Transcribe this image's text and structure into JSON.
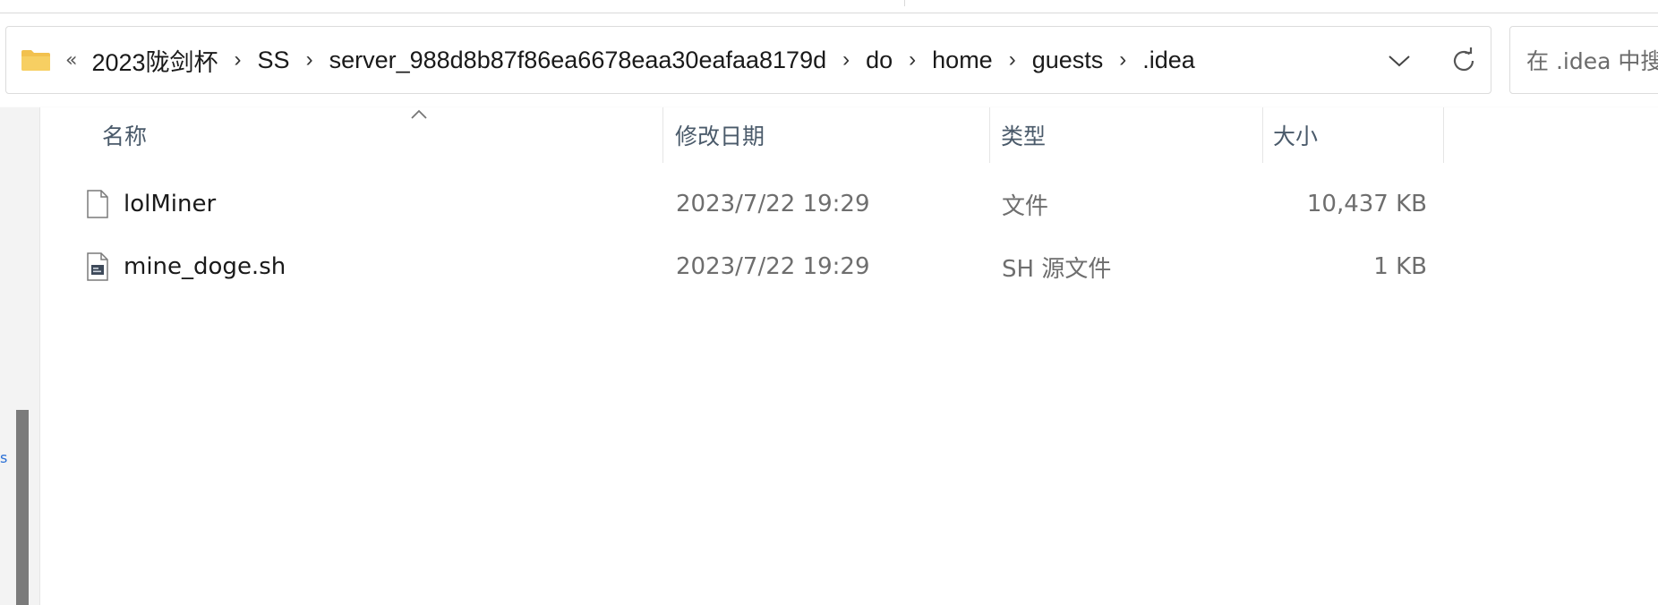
{
  "address": {
    "overflow": "«",
    "crumbs": [
      "2023陇剑杯",
      "SS",
      "server_988d8b87f86ea6678eaa30eafaa8179d",
      "do",
      "home",
      "guests",
      ".idea"
    ],
    "separator": "›"
  },
  "search": {
    "placeholder": "在 .idea 中搜"
  },
  "columns": {
    "name": "名称",
    "modified": "修改日期",
    "type": "类型",
    "size": "大小"
  },
  "files": [
    {
      "name": "lolMiner",
      "modified": "2023/7/22 19:29",
      "type": "文件",
      "size": "10,437 KB",
      "icon": "blank-file-icon"
    },
    {
      "name": "mine_doge.sh",
      "modified": "2023/7/22 19:29",
      "type": "SH 源文件",
      "size": "1 KB",
      "icon": "script-file-icon"
    }
  ],
  "colors": {
    "folder": "#f2c14e",
    "header_text": "#4a5a6a",
    "muted_text": "#6e6e6e"
  },
  "left_pane": {
    "mark": "s"
  }
}
